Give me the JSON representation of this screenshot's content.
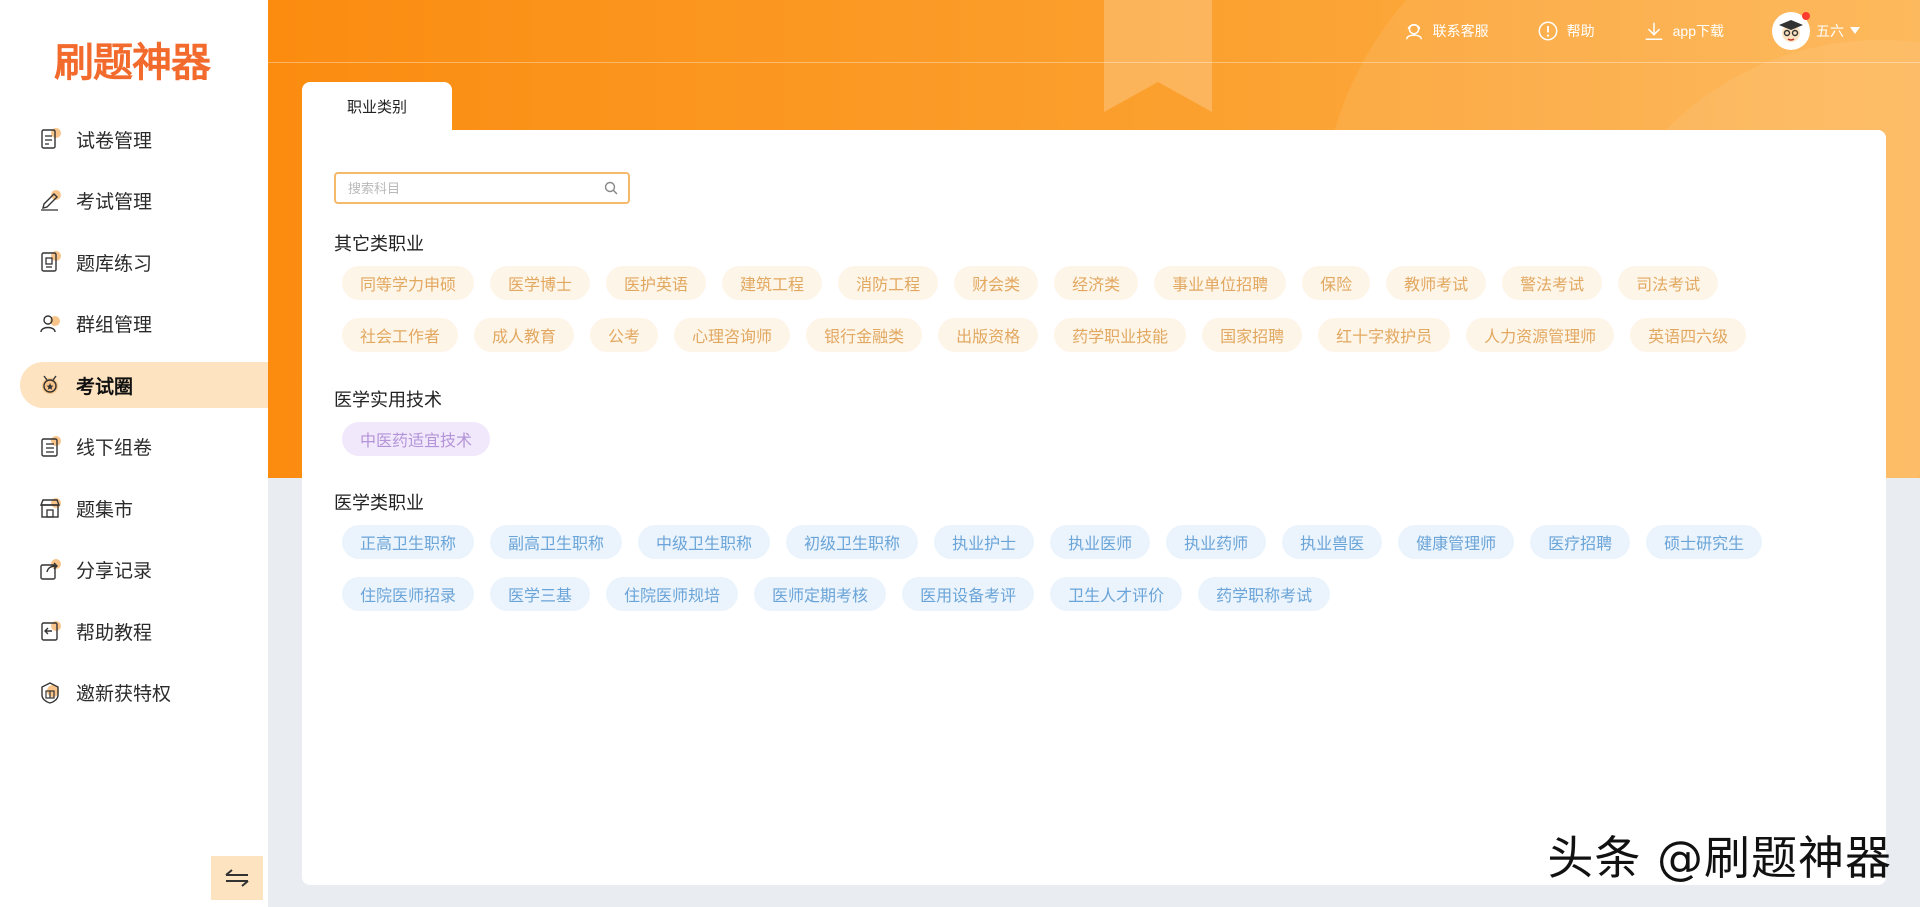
{
  "app": {
    "logo": "刷题神器"
  },
  "sidebar": {
    "items": [
      {
        "label": "试卷管理",
        "icon": "document-icon"
      },
      {
        "label": "考试管理",
        "icon": "pen-icon"
      },
      {
        "label": "题库练习",
        "icon": "question-bank-icon"
      },
      {
        "label": "群组管理",
        "icon": "group-icon"
      },
      {
        "label": "考试圈",
        "icon": "medal-icon",
        "active": true
      },
      {
        "label": "线下组卷",
        "icon": "book-stack-icon"
      },
      {
        "label": "题集市",
        "icon": "store-icon"
      },
      {
        "label": "分享记录",
        "icon": "share-icon"
      },
      {
        "label": "帮助教程",
        "icon": "help-book-icon"
      },
      {
        "label": "邀新获特权",
        "icon": "gift-badge-icon"
      }
    ]
  },
  "topbar": {
    "service": "联系客服",
    "help": "帮助",
    "download": "app下载",
    "user": "五六"
  },
  "tab": {
    "label": "职业类别"
  },
  "search": {
    "placeholder": "搜索科目",
    "value": ""
  },
  "sections": [
    {
      "title": "其它类职业",
      "color": "orange",
      "tags": [
        "同等学力申硕",
        "医学博士",
        "医护英语",
        "建筑工程",
        "消防工程",
        "财会类",
        "经济类",
        "事业单位招聘",
        "保险",
        "教师考试",
        "警法考试",
        "司法考试",
        "社会工作者",
        "成人教育",
        "公考",
        "心理咨询师",
        "银行金融类",
        "出版资格",
        "药学职业技能",
        "国家招聘",
        "红十字救护员",
        "人力资源管理师",
        "英语四六级"
      ]
    },
    {
      "title": "医学实用技术",
      "color": "purple",
      "tags": [
        "中医药适宜技术"
      ]
    },
    {
      "title": "医学类职业",
      "color": "blue",
      "tags": [
        "正高卫生职称",
        "副高卫生职称",
        "中级卫生职称",
        "初级卫生职称",
        "执业护士",
        "执业医师",
        "执业药师",
        "执业兽医",
        "健康管理师",
        "医疗招聘",
        "硕士研究生",
        "住院医师招录",
        "医学三基",
        "住院医师规培",
        "医师定期考核",
        "医用设备考评",
        "卫生人才评价",
        "药学职称考试"
      ]
    }
  ],
  "watermark": "头条 @刷题神器",
  "colors": {
    "accent": "#fb8c10",
    "orange_tag": "#e2a860",
    "purple_tag": "#b494d8",
    "blue_tag": "#6aa4d8"
  }
}
